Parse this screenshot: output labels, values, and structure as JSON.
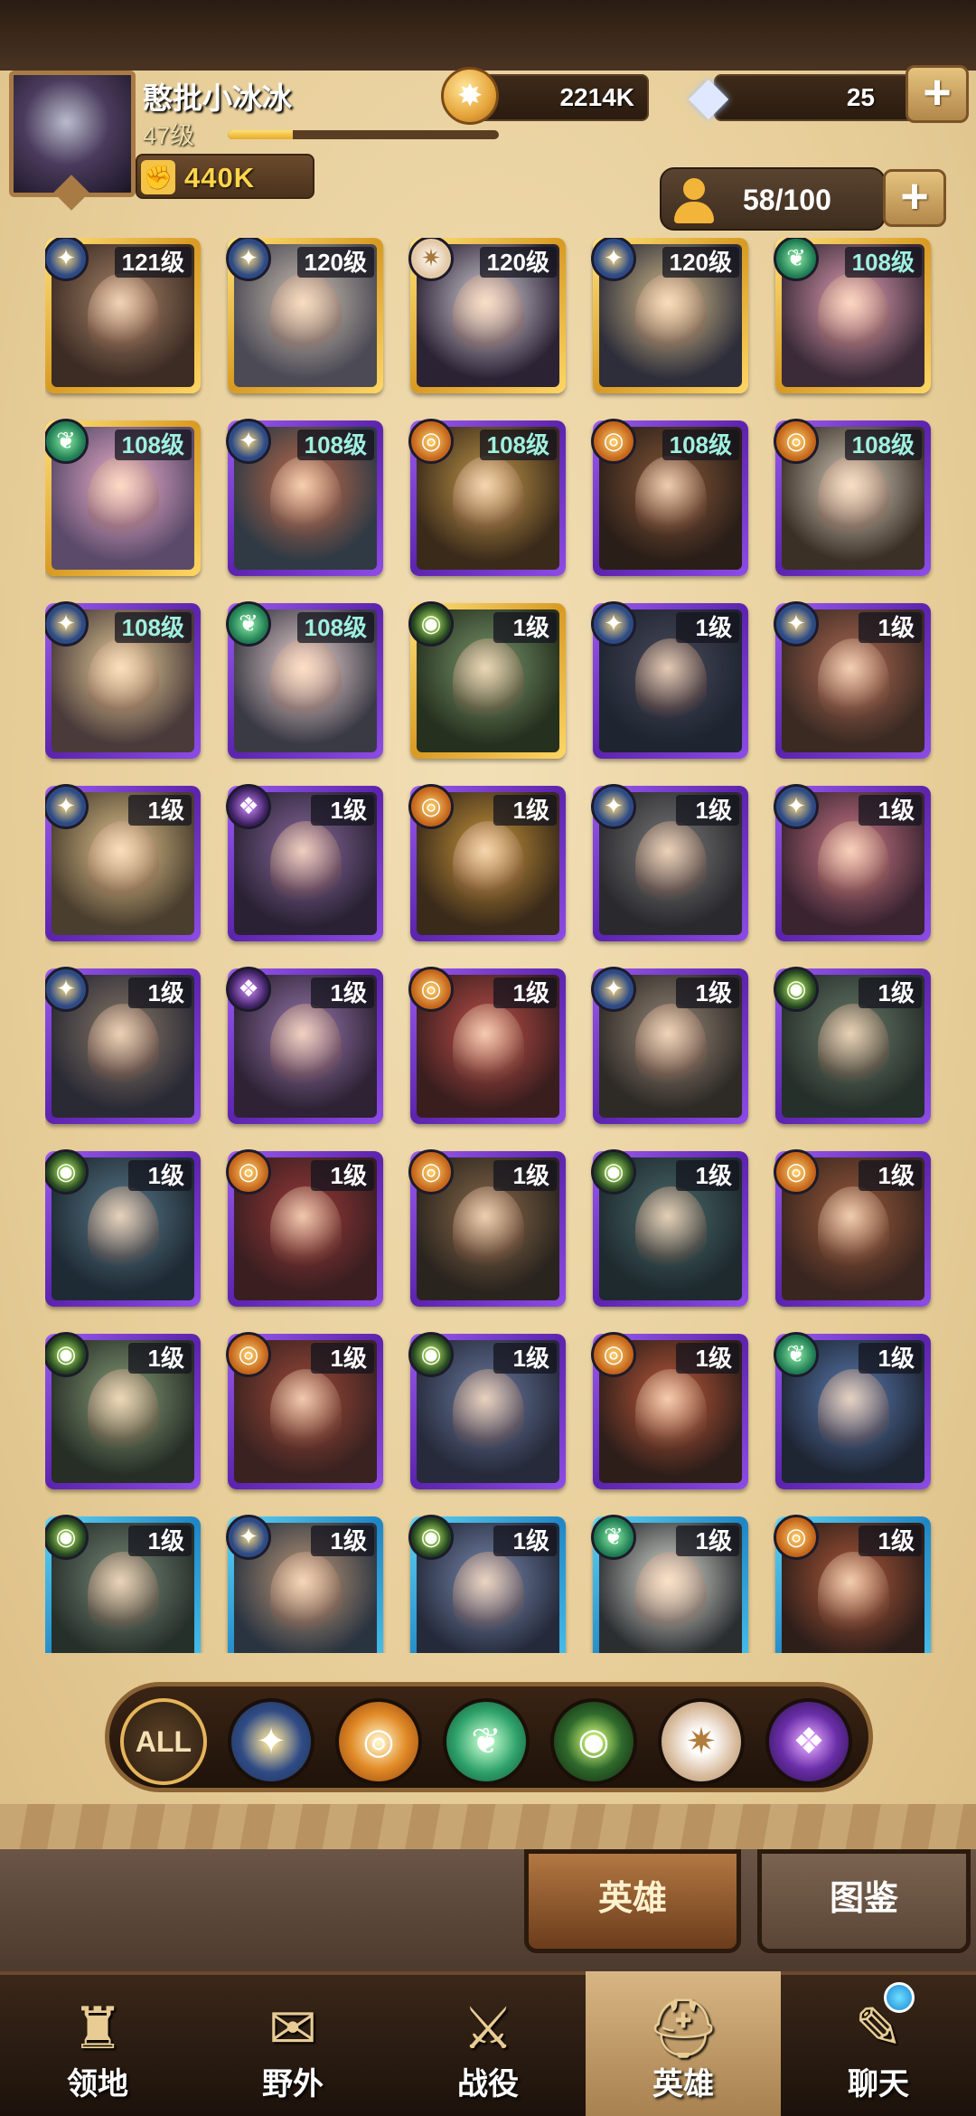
{
  "player": {
    "name": "憨批小冰冰",
    "level": "47级",
    "xp_progress": 0.24,
    "power": "440K"
  },
  "currency": {
    "gold": "2214K",
    "gems": "25",
    "plus_label": "+"
  },
  "roster": {
    "count": "58/100"
  },
  "heroes": [
    {
      "level": "121级",
      "faction": "lightbearer-star",
      "tier": "gold"
    },
    {
      "level": "120级",
      "faction": "lightbearer-star",
      "tier": "gold"
    },
    {
      "level": "120级",
      "faction": "celestial",
      "tier": "gold"
    },
    {
      "level": "120级",
      "faction": "lightbearer-star",
      "tier": "gold"
    },
    {
      "level": "108级",
      "faction": "wilder",
      "tier": "gold"
    },
    {
      "level": "108级",
      "faction": "wilder",
      "tier": "gold"
    },
    {
      "level": "108级",
      "faction": "lightbearer-star",
      "tier": "purple"
    },
    {
      "level": "108级",
      "faction": "lightbearer",
      "tier": "purple"
    },
    {
      "level": "108级",
      "faction": "lightbearer",
      "tier": "purple"
    },
    {
      "level": "108级",
      "faction": "lightbearer",
      "tier": "purple"
    },
    {
      "level": "108级",
      "faction": "lightbearer-star",
      "tier": "purple"
    },
    {
      "level": "108级",
      "faction": "wilder",
      "tier": "purple"
    },
    {
      "level": "1级",
      "faction": "graveborn",
      "tier": "gold"
    },
    {
      "level": "1级",
      "faction": "lightbearer-star",
      "tier": "purple"
    },
    {
      "level": "1级",
      "faction": "lightbearer-star",
      "tier": "purple"
    },
    {
      "level": "1级",
      "faction": "lightbearer-star",
      "tier": "purple"
    },
    {
      "level": "1级",
      "faction": "mauler",
      "tier": "purple"
    },
    {
      "level": "1级",
      "faction": "lightbearer",
      "tier": "purple"
    },
    {
      "level": "1级",
      "faction": "lightbearer-star",
      "tier": "purple"
    },
    {
      "level": "1级",
      "faction": "lightbearer-star",
      "tier": "purple"
    },
    {
      "level": "1级",
      "faction": "lightbearer-star",
      "tier": "purple"
    },
    {
      "level": "1级",
      "faction": "mauler",
      "tier": "purple"
    },
    {
      "level": "1级",
      "faction": "lightbearer",
      "tier": "purple"
    },
    {
      "level": "1级",
      "faction": "lightbearer-star",
      "tier": "purple"
    },
    {
      "level": "1级",
      "faction": "graveborn",
      "tier": "purple"
    },
    {
      "level": "1级",
      "faction": "graveborn",
      "tier": "purple"
    },
    {
      "level": "1级",
      "faction": "lightbearer",
      "tier": "purple"
    },
    {
      "level": "1级",
      "faction": "lightbearer",
      "tier": "purple"
    },
    {
      "level": "1级",
      "faction": "graveborn",
      "tier": "purple"
    },
    {
      "level": "1级",
      "faction": "lightbearer",
      "tier": "purple"
    },
    {
      "level": "1级",
      "faction": "graveborn",
      "tier": "purple"
    },
    {
      "level": "1级",
      "faction": "lightbearer",
      "tier": "purple"
    },
    {
      "level": "1级",
      "faction": "graveborn",
      "tier": "purple"
    },
    {
      "level": "1级",
      "faction": "lightbearer",
      "tier": "purple"
    },
    {
      "level": "1级",
      "faction": "wilder",
      "tier": "purple"
    },
    {
      "level": "1级",
      "faction": "graveborn",
      "tier": "blue"
    },
    {
      "level": "1级",
      "faction": "lightbearer-star",
      "tier": "blue"
    },
    {
      "level": "1级",
      "faction": "graveborn",
      "tier": "blue"
    },
    {
      "level": "1级",
      "faction": "wilder",
      "tier": "blue"
    },
    {
      "level": "1级",
      "faction": "lightbearer",
      "tier": "blue"
    }
  ],
  "filters": {
    "all_label": "ALL"
  },
  "subtabs": {
    "heroes": "英雄",
    "archive": "图鉴"
  },
  "nav": {
    "territory": "领地",
    "wilds": "野外",
    "campaign": "战役",
    "heroes": "英雄",
    "chat": "聊天"
  }
}
